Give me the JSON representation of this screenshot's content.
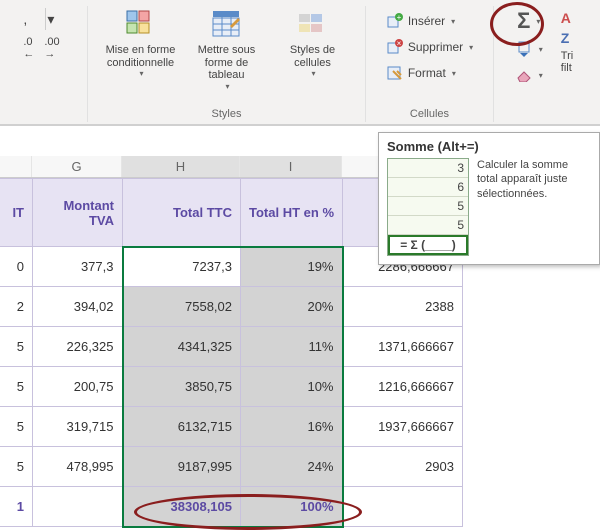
{
  "ribbon": {
    "number_group": {
      "decrease_dec": "←0",
      "increase_dec": "→0",
      "comma": ","
    },
    "styles_group": {
      "label": "Styles",
      "cond_fmt": "Mise en forme conditionnelle",
      "table_fmt": "Mettre sous forme de tableau",
      "cell_styles": "Styles de cellules"
    },
    "cells_group": {
      "label": "Cellules",
      "insert": "Insérer",
      "delete": "Supprimer",
      "format": "Format"
    },
    "editing_group": {
      "label": "",
      "sort": "Tri",
      "filter": "filt"
    }
  },
  "tooltip": {
    "title": "Somme (Alt+=)",
    "mini_values": [
      "3",
      "6",
      "5",
      "5"
    ],
    "mini_formula": "= Σ (____)",
    "text": "Calculer la somme total apparaît juste sélectionnées."
  },
  "sheet": {
    "columns": [
      "",
      "G",
      "H",
      "I",
      ""
    ],
    "headers": {
      "F": "IT",
      "G": "Montant TVA",
      "H": "Total TTC",
      "I": "Total HT en %",
      "J": ""
    },
    "rows": [
      {
        "F": "0",
        "G": "377,3",
        "H": "7237,3",
        "I": "19%",
        "J": "2286,666667"
      },
      {
        "F": "2",
        "G": "394,02",
        "H": "7558,02",
        "I": "20%",
        "J": "2388"
      },
      {
        "F": "5",
        "G": "226,325",
        "H": "4341,325",
        "I": "11%",
        "J": "1371,666667"
      },
      {
        "F": "5",
        "G": "200,75",
        "H": "3850,75",
        "I": "10%",
        "J": "1216,666667"
      },
      {
        "F": "5",
        "G": "319,715",
        "H": "6132,715",
        "I": "16%",
        "J": "1937,666667"
      },
      {
        "F": "5",
        "G": "478,995",
        "H": "9187,995",
        "I": "24%",
        "J": "2903"
      }
    ],
    "sum": {
      "F": "1",
      "G": "",
      "H": "38308,105",
      "I": "100%",
      "J": ""
    }
  }
}
